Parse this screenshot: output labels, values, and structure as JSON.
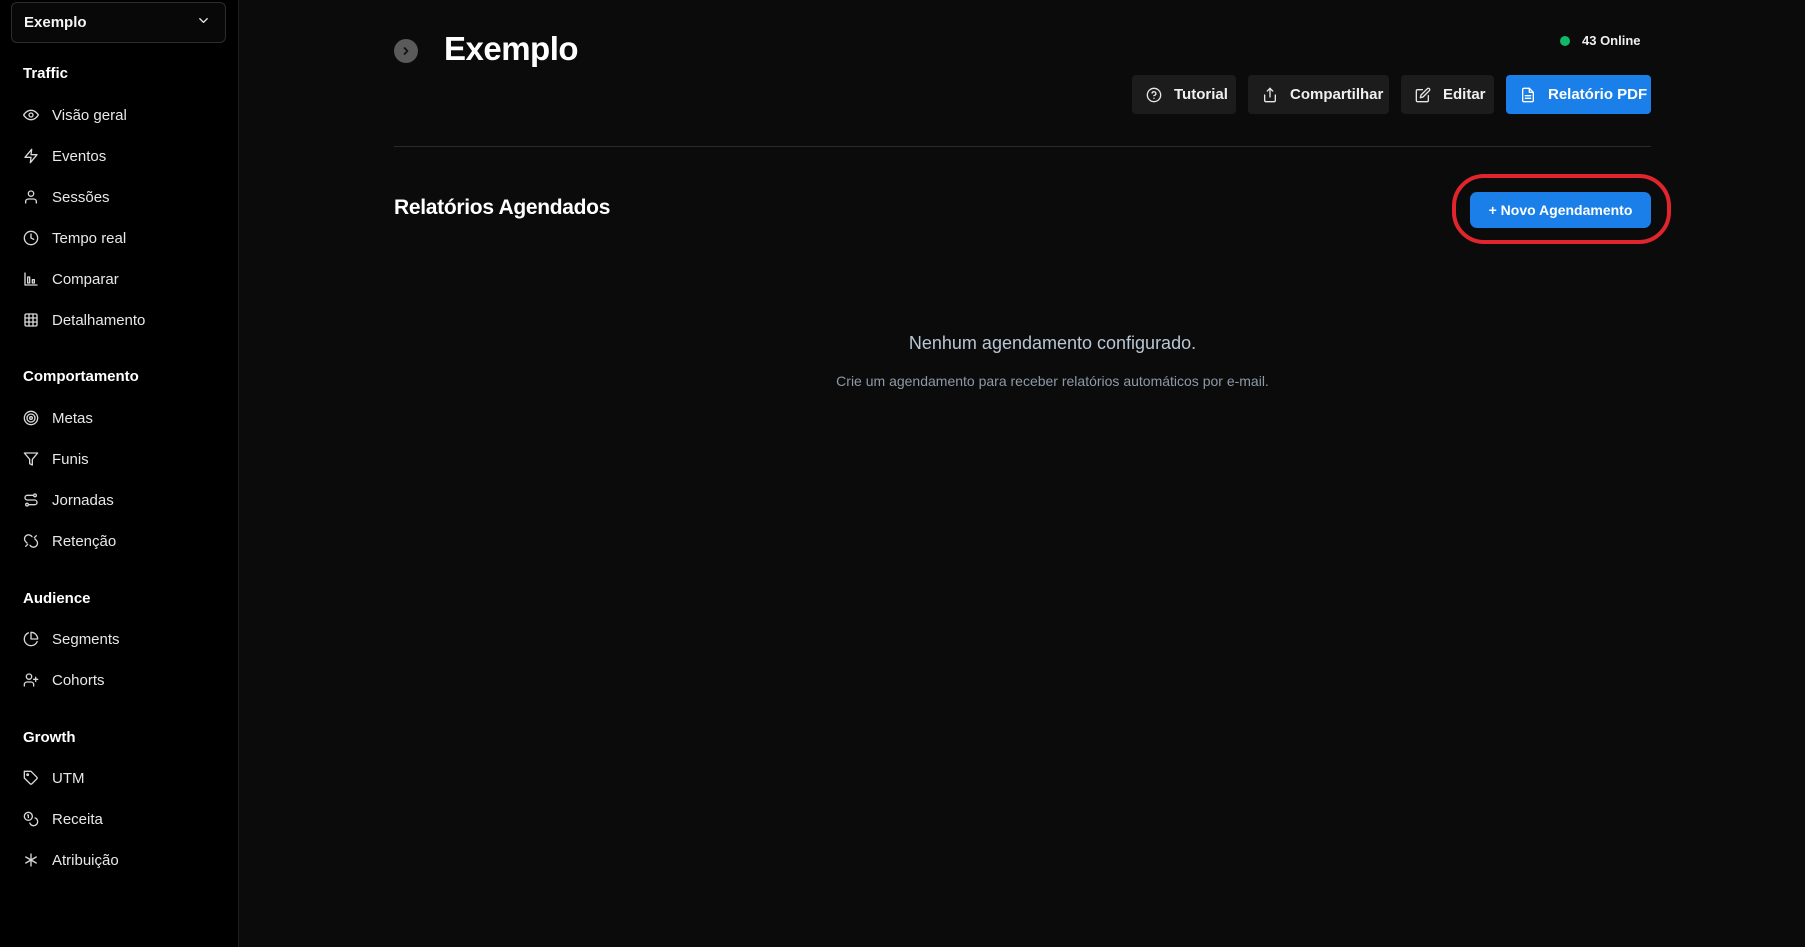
{
  "site_selector": {
    "value": "Exemplo"
  },
  "sidebar": {
    "sections": [
      {
        "heading": "Traffic",
        "items": [
          {
            "label": "Visão geral",
            "icon": "eye-icon"
          },
          {
            "label": "Eventos",
            "icon": "bolt-icon"
          },
          {
            "label": "Sessões",
            "icon": "user-icon"
          },
          {
            "label": "Tempo real",
            "icon": "clock-icon"
          },
          {
            "label": "Comparar",
            "icon": "bar-chart-icon"
          },
          {
            "label": "Detalhamento",
            "icon": "table-icon"
          }
        ]
      },
      {
        "heading": "Comportamento",
        "items": [
          {
            "label": "Metas",
            "icon": "target-icon"
          },
          {
            "label": "Funis",
            "icon": "funnel-icon"
          },
          {
            "label": "Jornadas",
            "icon": "route-icon"
          },
          {
            "label": "Retenção",
            "icon": "magnet-icon"
          }
        ]
      },
      {
        "heading": "Audience",
        "items": [
          {
            "label": "Segments",
            "icon": "pie-chart-icon"
          },
          {
            "label": "Cohorts",
            "icon": "user-plus-icon"
          }
        ]
      },
      {
        "heading": "Growth",
        "items": [
          {
            "label": "UTM",
            "icon": "tag-icon"
          },
          {
            "label": "Receita",
            "icon": "coins-icon"
          },
          {
            "label": "Atribuição",
            "icon": "asterisk-icon"
          }
        ]
      }
    ]
  },
  "header": {
    "title": "Exemplo",
    "online_text": "43 Online",
    "buttons": {
      "tutorial": "Tutorial",
      "share": "Compartilhar",
      "edit": "Editar",
      "pdf": "Relatório PDF"
    }
  },
  "scheduled": {
    "title": "Relatórios Agendados",
    "new_button": "+ Novo Agendamento",
    "empty_title": "Nenhum agendamento configurado.",
    "empty_subtitle": "Crie um agendamento para receber relatórios automáticos por e-mail."
  },
  "colors": {
    "accent": "#1a7fe8",
    "online": "#12b76a",
    "highlight": "#e0252c"
  }
}
